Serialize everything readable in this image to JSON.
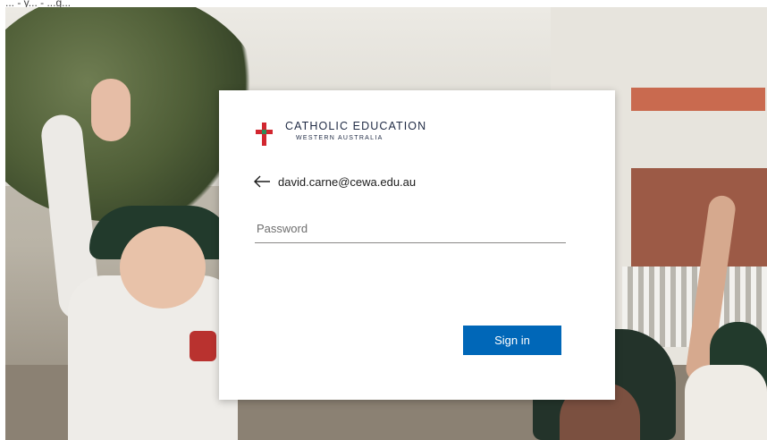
{
  "caption": "... - y... - ...g...",
  "branding": {
    "title": "CATHOLIC EDUCATION",
    "subtitle": "WESTERN AUSTRALIA",
    "accent_color": "#d2262f"
  },
  "identity": {
    "email": "david.carne@cewa.edu.au",
    "back_icon": "back-arrow-icon"
  },
  "password": {
    "value": "",
    "placeholder": "Password"
  },
  "sign_in": {
    "label": "Sign in",
    "color": "#0067b8"
  }
}
